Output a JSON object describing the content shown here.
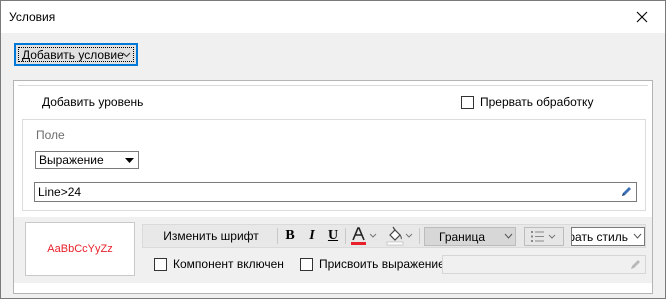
{
  "window": {
    "title": "Условия"
  },
  "add_condition_button": {
    "label": "Добавить условие"
  },
  "panel": {
    "add_level_label": "Добавить уровень",
    "stop_processing": {
      "label": "Прервать обработку",
      "checked": false
    },
    "field": {
      "label": "Поле",
      "type_select": {
        "value": "Выражение"
      },
      "expression": {
        "value": "Line>24"
      }
    },
    "format": {
      "preview_text": "AaBbCcYyZz",
      "change_font_label": "Изменить шрифт",
      "bold": "B",
      "italic": "I",
      "underline": "U",
      "font_color_letter": "A",
      "font_color": "#e8202a",
      "border_select": {
        "value": "Граница"
      },
      "style_select": {
        "value": "Выбрать стиль"
      },
      "component_enabled": {
        "label": "Компонент включен",
        "checked": false
      },
      "assign_expression": {
        "label": "Присвоить выражение",
        "checked": false
      }
    }
  }
}
